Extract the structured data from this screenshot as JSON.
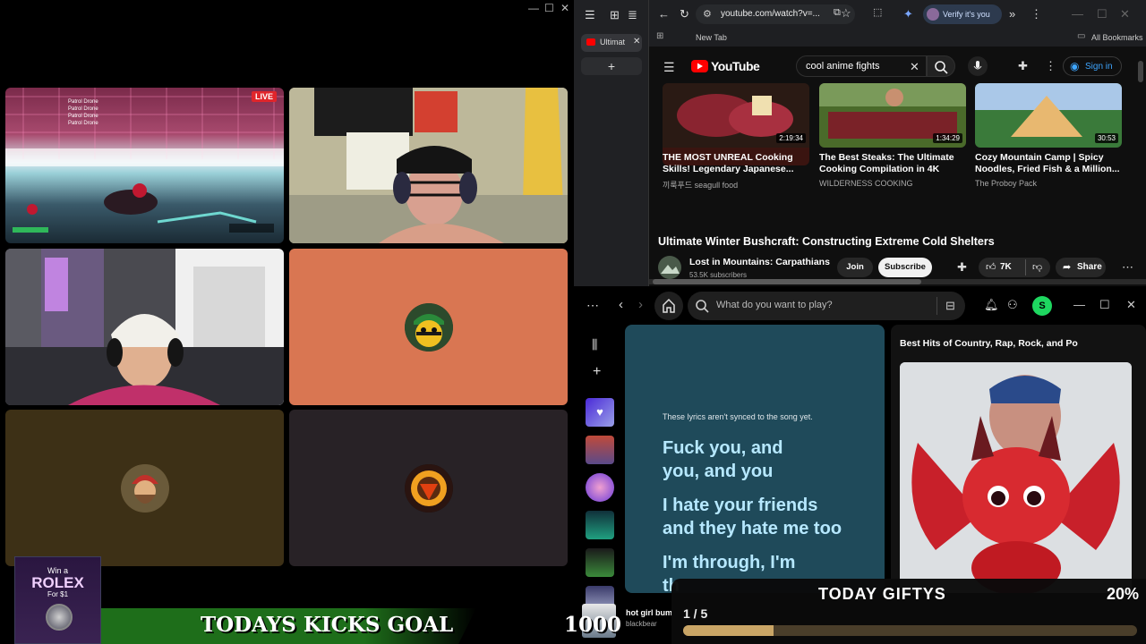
{
  "call": {
    "window_controls": [
      "—",
      "☐",
      "✕"
    ],
    "live_label": "LIVE",
    "game_hud_lines": [
      "Patrol Drone",
      "Patrol Drone",
      "Patrol Drone",
      "Patrol Drone"
    ]
  },
  "browser": {
    "tab_title": "Ultimat",
    "url": "youtube.com/watch?v=...",
    "verify_label": "Verify it's you",
    "bookmark_new_tab": "New Tab",
    "all_bookmarks": "All Bookmarks",
    "youtube": {
      "logo_text": "YouTube",
      "search_value": "cool anime fights",
      "sign_in_label": "Sign in",
      "videos": [
        {
          "title": "THE MOST UNREAL Cooking Skills! Legendary Japanese...",
          "channel": "끼룩푸드 seagull food",
          "duration": "2:19:34"
        },
        {
          "title": "The Best Steaks: The Ultimate Cooking Compilation in 4K",
          "channel": "WILDERNESS COOKING",
          "duration": "1:34:29"
        },
        {
          "title": "Cozy Mountain Camp | Spicy Noodles, Fried Fish & a Million...",
          "channel": "The Proboy Pack",
          "duration": "30:53"
        }
      ],
      "video_title": "Ultimate Winter Bushcraft: Constructing Extreme Cold Shelters",
      "channel_name": "Lost in Mountains: Carpathians",
      "subscribers": "53.5K subscribers",
      "join_label": "Join",
      "subscribe_label": "Subscribe",
      "likes": "7K",
      "share_label": "Share"
    }
  },
  "spotify": {
    "search_placeholder": "What do you want to play?",
    "avatar_letter": "S",
    "lyrics_notice": "These lyrics aren't synced to the song yet.",
    "lyric_lines": [
      "Fuck you, and",
      "you, and you",
      "I hate your friends",
      "and they hate me too",
      "I'm through, I'm",
      "th"
    ],
    "playlist_title": "Best Hits of Country, Rap, Rock, and Po",
    "now_playing_title": "hot girl bum",
    "now_playing_artist": "blackbear"
  },
  "overlays": {
    "kicks_goal_label": "TODAYS KICKS GOAL",
    "kicks_goal_value": "1000",
    "rolex": {
      "line1": "Win a",
      "line2": "ROLEX",
      "line3": "For $1"
    },
    "gift": {
      "title": "TODAY GIFTYS",
      "percent": "20%",
      "count": "1 / 5",
      "progress": 0.2
    }
  },
  "colors": {
    "yt_red": "#ff0000",
    "spotify_green": "#1ed760",
    "lyrics_bg": "#1f4a5a",
    "goal_green": "#1e6e1a",
    "gift_bar": "#c9a566",
    "tile_orange": "#d97652",
    "tile_olive": "#3d3016",
    "tile_dark": "#282226"
  }
}
